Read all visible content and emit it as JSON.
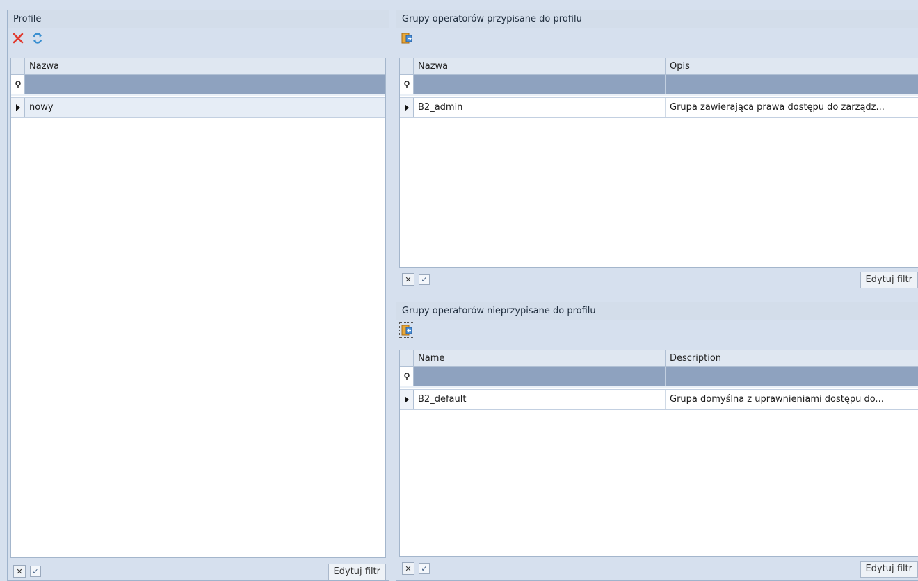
{
  "left_panel": {
    "title": "Profile",
    "toolbar": {
      "delete_icon": "delete-x-icon",
      "refresh_icon": "refresh-icon"
    },
    "columns": [
      "Nazwa"
    ],
    "rows": [
      {
        "name": "nowy"
      }
    ],
    "footer": {
      "edit_filter": "Edytuj filtr"
    }
  },
  "assigned_panel": {
    "title": "Grupy operatorów przypisane do profilu",
    "columns": [
      "Nazwa",
      "Opis"
    ],
    "rows": [
      {
        "name": "B2_admin",
        "description": "Grupa zawierająca prawa dostępu do zarządz..."
      }
    ],
    "footer": {
      "edit_filter": "Edytuj filtr"
    }
  },
  "unassigned_panel": {
    "title": "Grupy operatorów nieprzypisane do profilu",
    "columns": [
      "Name",
      "Description"
    ],
    "rows": [
      {
        "name": "B2_default",
        "description": "Grupa domyślna z uprawnieniami dostępu do..."
      }
    ],
    "footer": {
      "edit_filter": "Edytuj filtr"
    }
  },
  "colors": {
    "accent": "#8ea2bf",
    "background": "#d6e0ee",
    "delete_red": "#e03a2f",
    "refresh_blue": "#3a8fd0"
  }
}
